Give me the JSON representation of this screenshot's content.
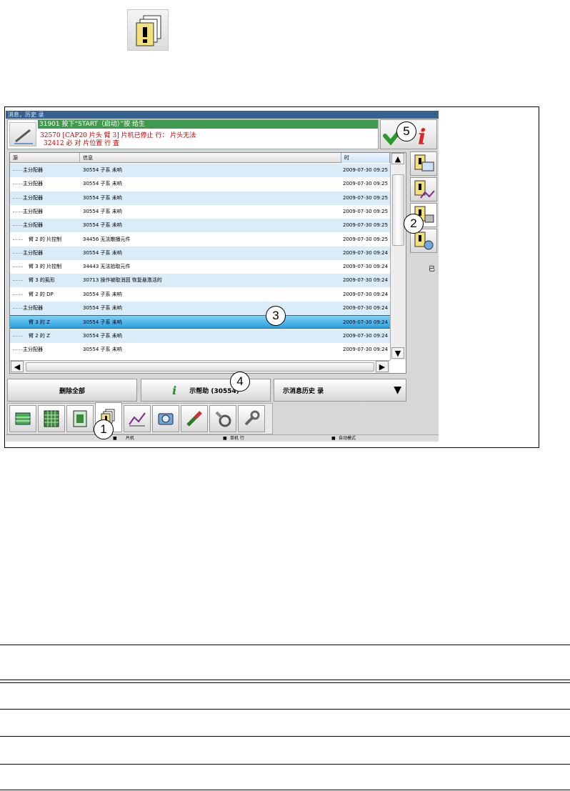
{
  "title_bar": "消息，历史  录",
  "message_panel": {
    "line1": "31901 按下“START（启动）”按    给生",
    "line2": "32570 [CAP20  片头  臂 3]  片机已停止  行：  片头无法",
    "line3": "32412 必  对  片位置  行  査"
  },
  "table": {
    "headers": [
      "源",
      "信息",
      "时"
    ],
    "rows": [
      {
        "source": "主分配器",
        "info": "30554 子系  未响",
        "time": "2009-07-30 09:25",
        "style": "blue"
      },
      {
        "source": "主分配器",
        "info": "30554 子系  未响",
        "time": "2009-07-30 09:25",
        "style": "white"
      },
      {
        "source": "主分配器",
        "info": "30554 子系  未响",
        "time": "2009-07-30 09:25",
        "style": "blue"
      },
      {
        "source": "主分配器",
        "info": "30554 子系  未响",
        "time": "2009-07-30 09:25",
        "style": "white"
      },
      {
        "source": "主分配器",
        "info": "30554 子系  未响",
        "time": "2009-07-30 09:25",
        "style": "blue"
      },
      {
        "source": "臂 2 的  片控制",
        "info": "34456 无法散播元件",
        "time": "2009-07-30 09:25",
        "style": "white"
      },
      {
        "source": "主分配器",
        "info": "30554 子系  未响",
        "time": "2009-07-30 09:24",
        "style": "blue"
      },
      {
        "source": "臂 3 的  片控制",
        "info": "34443 无法拾取元件",
        "time": "2009-07-30 09:24",
        "style": "white"
      },
      {
        "source": "臂 3 的虱形",
        "info": "30713 操作被取消因        恢复悬激活的",
        "time": "2009-07-30 09:24",
        "style": "blue"
      },
      {
        "source": "臂 2 的 DP",
        "info": "30554 子系  未响",
        "time": "2009-07-30 09:24",
        "style": "white"
      },
      {
        "source": "主分配器",
        "info": "30554 子系  未响",
        "time": "2009-07-30 09:24",
        "style": "blue"
      },
      {
        "source": "臂 3 的 Z",
        "info": "30554 子系  未响",
        "time": "2009-07-30 09:24",
        "style": "selected"
      },
      {
        "source": "臂 2 的 Z",
        "info": "30554 子系  未响",
        "time": "2009-07-30 09:24",
        "style": "blue"
      },
      {
        "source": "主分配器",
        "info": "30554 子系  未响",
        "time": "2009-07-30 09:24",
        "style": "white"
      }
    ]
  },
  "actions": {
    "delete_all": "删除全部",
    "show_help": "示帮助 (30554)",
    "show_history": "示消息历史  录"
  },
  "side_label": "已",
  "status": {
    "s1": "片机",
    "s2": "单机  行",
    "s3": "自动模式"
  },
  "callouts": [
    "1",
    "2",
    "3",
    "4",
    "5"
  ],
  "colors": {
    "title_bg": "#34618f",
    "message_green": "#3f9a4d",
    "message_red": "#c00000",
    "row_blue": "#d9ecf8",
    "row_selected": "#2c9fe0"
  }
}
